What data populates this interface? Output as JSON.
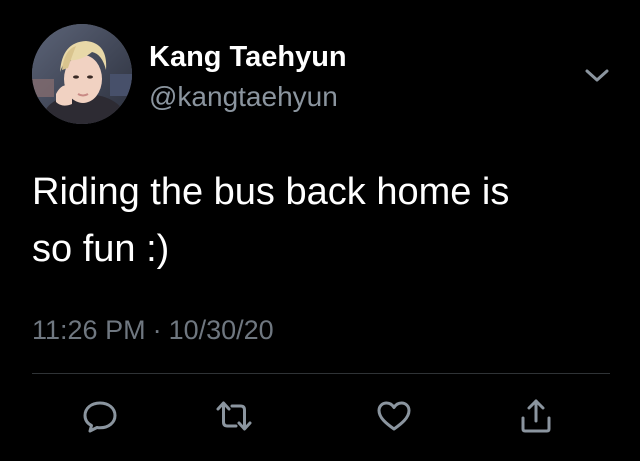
{
  "tweet": {
    "author": {
      "display_name": "Kang Taehyun",
      "handle": "@kangtaehyun",
      "avatar_icon": "profile-photo"
    },
    "text_lines": [
      "Riding the bus back home is",
      "so fun :)"
    ],
    "time": "11:26 PM",
    "separator": "·",
    "date": "10/30/20",
    "actions": [
      {
        "name": "reply",
        "icon": "speech-bubble-icon"
      },
      {
        "name": "retweet",
        "icon": "retweet-arrows-icon"
      },
      {
        "name": "like",
        "icon": "heart-icon"
      },
      {
        "name": "share",
        "icon": "share-upload-icon"
      }
    ],
    "menu_icon": "chevron-down-icon"
  },
  "colors": {
    "background": "#000000",
    "primary_text": "#ffffff",
    "secondary_text": "#8b959f",
    "icon": "#8b959f",
    "divider": "#2f3336"
  }
}
